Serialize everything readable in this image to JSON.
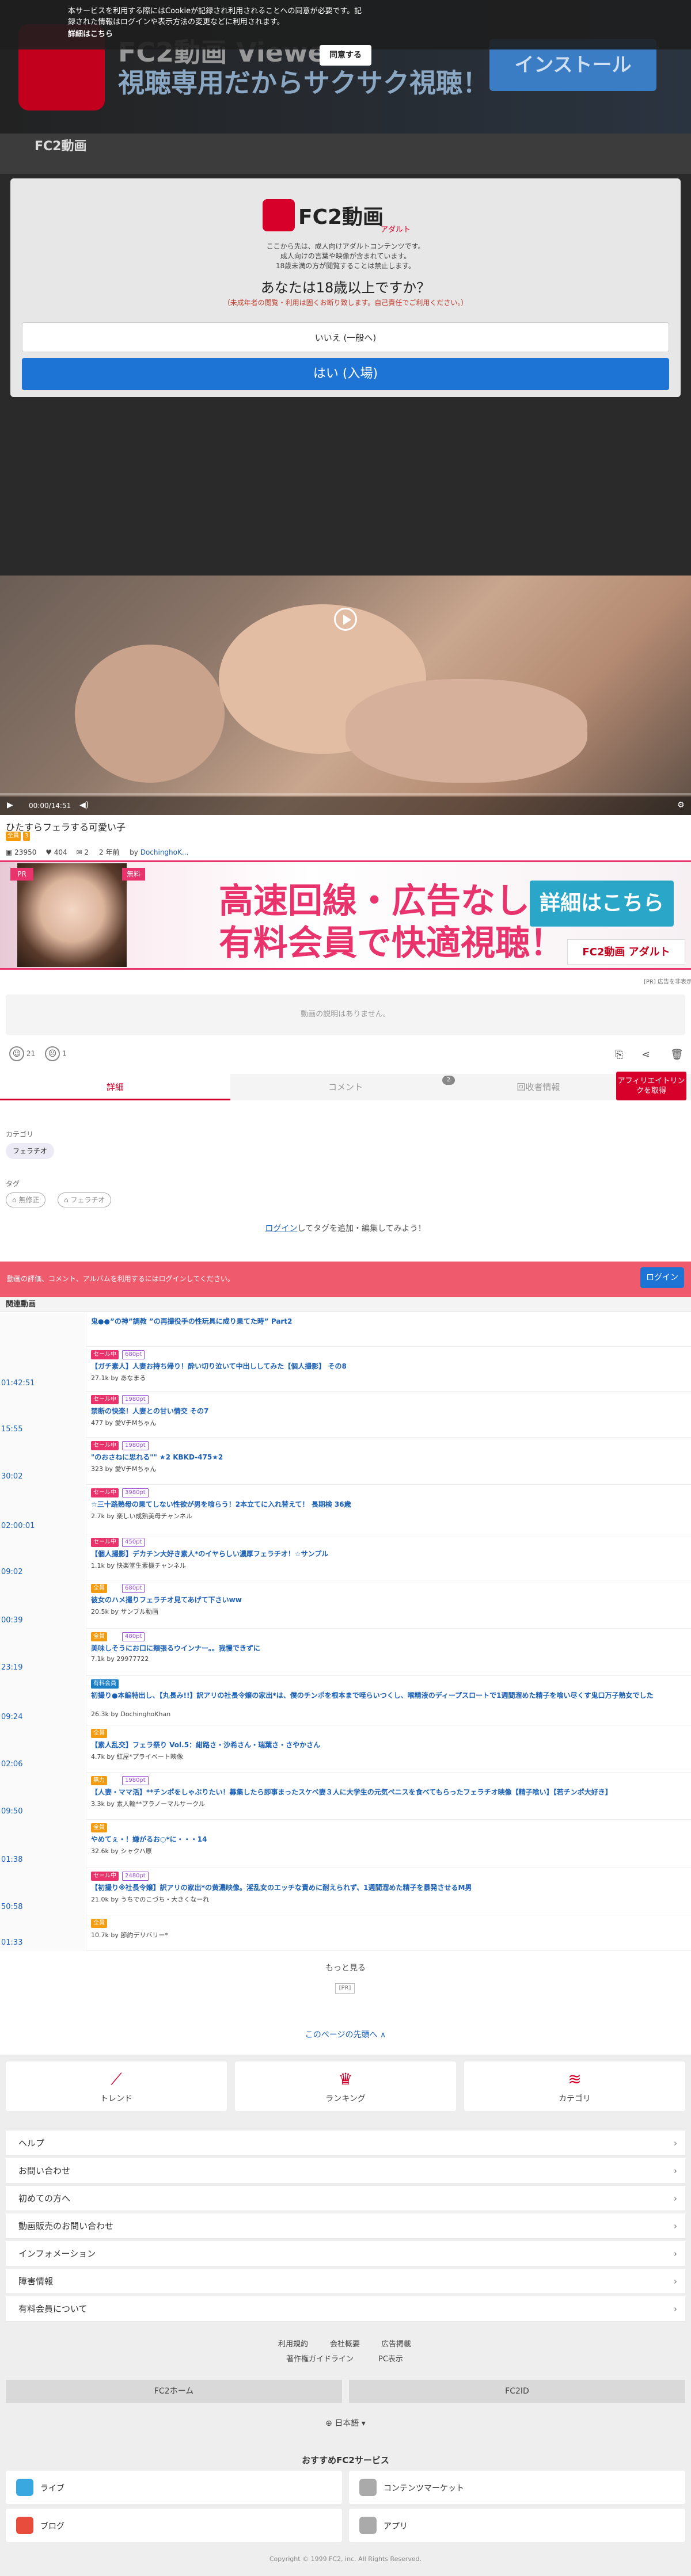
{
  "cookie": {
    "text": "本サービスを利用する際にはCookieが記録され利用されることへの同意が必要です。記録された情報はログインや表示方法の変更などに利用されます。",
    "more": "詳細はこちら",
    "agree": "同意する"
  },
  "top_banner": {
    "line1": "FC2動画 Viewer",
    "line2": "視聴専用だからサクサク視聴！",
    "button": "インストール"
  },
  "header": {
    "logo": "FC2動画"
  },
  "age_modal": {
    "logo": "FC2動画",
    "logo_sub": "アダルト",
    "lines": [
      "ここから先は、成人向けアダルトコンテンツです。",
      "成人向けの言葉や映像が含まれています。",
      "18歳未満の方が閲覧することは禁止します。"
    ],
    "question": "あなたは18歳以上ですか？",
    "note": "（未成年者の閲覧・利用は固くお断り致します。自己責任でご利用ください。）",
    "no": "いいえ (一般へ)",
    "yes": "はい (入場)"
  },
  "player": {
    "time": "00:00/14:51",
    "progress": 0.0
  },
  "video": {
    "title": "ひたすらフェラする可愛い子",
    "tag1": "全員",
    "tag2": "3",
    "views": "23950",
    "likes": "404",
    "comments": "2",
    "age": "2 年前",
    "by": "by",
    "author": "DochinghoK..."
  },
  "ad": {
    "badge1": "PR",
    "badge2": "無料",
    "line1": "高速回線・広告なし",
    "line2": "有料会員で快適視聴！",
    "button": "詳細はこちら",
    "logo": "FC2動画 アダルト",
    "pr": "[PR] 広告を非表示"
  },
  "description": "動画の説明はありません。",
  "reactions": {
    "good": "21",
    "bad": "1"
  },
  "tabs": {
    "detail": "詳細",
    "comment": "コメント",
    "comment_count": "2",
    "album": "回收者情報",
    "affiliate": "アフィリエイトリンクを取得"
  },
  "category": {
    "label": "カテゴリ",
    "value": "フェラチオ"
  },
  "tags": {
    "label": "タグ",
    "items": [
      "無修正",
      "フェラチオ"
    ],
    "login_link": "ログイン",
    "login_suffix": "してタグを追加・編集してみよう！"
  },
  "login_bar": {
    "text": "動画の評価、コメント、アルバムを利用するにはログインしてください。",
    "button": "ログイン"
  },
  "related": {
    "heading": "関連動画",
    "items": [
      {
        "duration": "",
        "title": "鬼●●”の神”調教 ”の再撮役手の性玩具に成り果てた時” Part2",
        "badge": "",
        "price": "",
        "meta": ""
      },
      {
        "duration": "01:42:51",
        "title": "【ガチ素人】人妻お持ち帰り！酔い切り泣いて中出ししてみた【個人撮影】 その8",
        "badge": "セール中",
        "price": "680pt",
        "meta": "27.1k by あなまる"
      },
      {
        "duration": "15:55",
        "title": "禁断の快楽！人妻との甘い情交 その7",
        "badge": "セール中",
        "price": "1980pt",
        "meta": "477 by 愛VチMちゃん"
      },
      {
        "duration": "30:02",
        "title": "\"のおさねに思れる\"\" ★2 KBKD-475★2",
        "badge": "セール中",
        "price": "1980pt",
        "meta": "323 by 愛VチMちゃん"
      },
      {
        "duration": "02:00:01",
        "title": "☆三十路熟母の果てしない性欲が男を喰らう！2本立てに入れ替えて！ 長期検 36歳",
        "badge": "セール中",
        "price": "3980pt",
        "meta": "2.7k by 楽しい成熟美母チャンネル"
      },
      {
        "duration": "09:02",
        "title": "【個人撮影】デカチン大好き素人*のイヤらしい濃厚フェラチオ！☆サンプル",
        "badge": "セール中",
        "price": "450pt",
        "meta": "1.1k by 快楽堂生素機チャンネル"
      },
      {
        "duration": "00:39",
        "title": "彼女のハメ撮りフェラチオ見てあげて下さいww",
        "badge": "全員",
        "price": "680pt",
        "meta": "20.5k by サンプル動画"
      },
      {
        "duration": "23:19",
        "title": "美味しそうにお口に頬張るウインナー。。我慢できずに",
        "badge": "全員",
        "price": "480pt",
        "meta": "7.1k by 29977722"
      },
      {
        "duration": "09:24",
        "title": "初撮り●本編特出し、【丸長み!!】訳アリの社長令嬢の家出*は、僕のチンポを根本まで咥らいつくし、喉精液のディープスロートで1週間溜めた精子を喰い尽くす鬼口万子熟女でした",
        "badge": "有料会員",
        "price": "",
        "meta": "26.3k by DochinghoKhan"
      },
      {
        "duration": "02:06",
        "title": "【素人乱交】フェラ祭り Vol.5：紺路さ・沙希さん・瑞葉さ・さやかさん",
        "badge": "全員",
        "price": "",
        "meta": "4.7k by 紅屋*プライベート映像"
      },
      {
        "duration": "09:50",
        "title": "【人妻・ママ活】**チンポをしゃぶりたい！募集したら即事まったスケベ妻３人に大学生の元気ペニスを食べてもらったフェラチオ映像【精子喰い】【若チンポ大好き】",
        "badge": "無力",
        "price": "1980pt",
        "meta": "3.3k by 素人輪**プラノーマルサークル"
      },
      {
        "duration": "01:38",
        "title": "やめてぇ・！嫌がるお○*に・・・14",
        "badge": "全員",
        "price": "",
        "meta": "32.6k by シャクハ原"
      },
      {
        "duration": "50:58",
        "title": "【初撮り※社長令嬢】訳アリの家出*の黄濃映像。淫乱女のエッチな責めに耐えられず、1週間溜めた精子を暴発させるM男",
        "badge": "セール中",
        "price": "2480pt",
        "meta": "21.0k by うちでのこづち・大きくなーれ"
      },
      {
        "duration": "01:33",
        "title": "",
        "badge": "全員",
        "price": "",
        "meta": "10.7k by 節約デリバリー*"
      }
    ],
    "more": "もっと見る",
    "pr": "[PR]",
    "page_top": "このページの先頭へ ∧"
  },
  "footer_nav": [
    {
      "icon": "trend-icon",
      "label": "トレンド"
    },
    {
      "icon": "ranking-icon",
      "label": "ランキング"
    },
    {
      "icon": "category-icon",
      "label": "カテゴリ"
    }
  ],
  "footer_links": [
    "ヘルプ",
    "お問い合わせ",
    "初めての方へ",
    "動画販売のお問い合わせ",
    "インフォメーション",
    "障害情報",
    "有料会員について"
  ],
  "small_links": [
    "利用規約",
    "会社概要",
    "広告掲載",
    "著作権ガイドライン",
    "PC表示"
  ],
  "footer_buttons": [
    "FC2ホーム",
    "FC2ID"
  ],
  "language": "日本語",
  "services": {
    "heading": "おすすめFC2サービス",
    "items": [
      "ライブ",
      "コンテンツマーケット",
      "ブログ",
      "アプリ"
    ]
  },
  "copyright": "Copyright © 1999 FC2, inc. All Rights Reserved."
}
